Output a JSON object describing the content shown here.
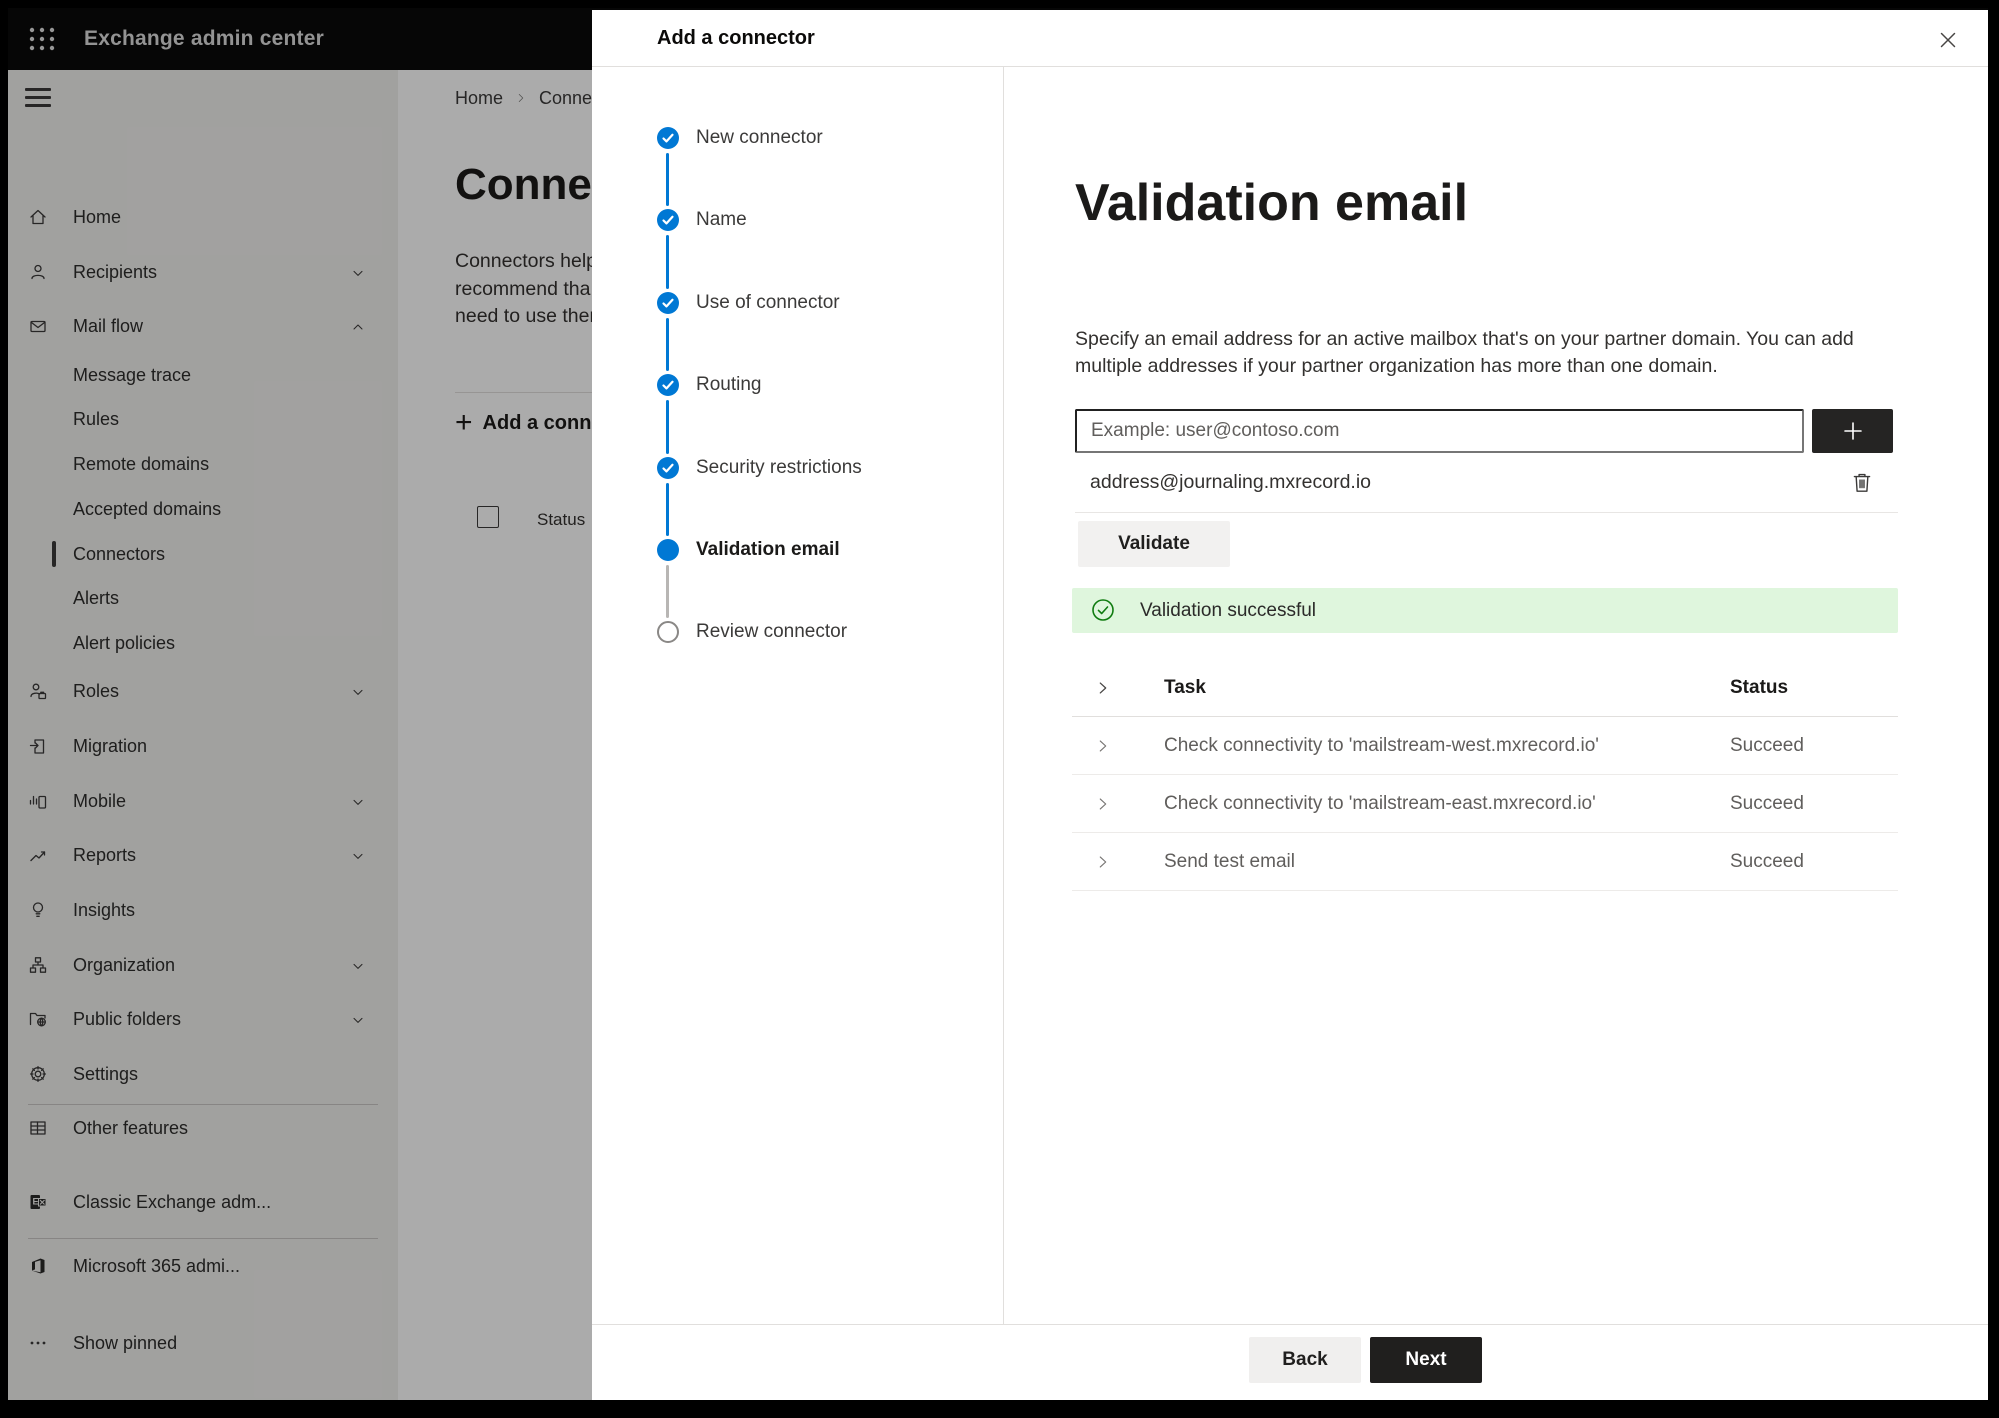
{
  "colors": {
    "accent": "#0078d4",
    "success": "#107c10",
    "success_bg": "#dff6dd",
    "topbar_bg": "#0a0a0a",
    "primary_btn": "#201f1e"
  },
  "icons": {
    "app_launcher": "waffle-grid-dots",
    "menu": "hamburger-lines",
    "step_done": "blue-circle-white-check",
    "step_current": "blue-filled-circle",
    "step_upcoming": "gray-outline-circle",
    "close": "x-cross",
    "add_address": "plus",
    "delete_address": "trash-outline",
    "success": "green-circle-check",
    "row_expander": "chevron-right",
    "nav_expand": "chevron-down",
    "nav_collapse": "chevron-up"
  },
  "topbar": {
    "title": "Exchange admin center"
  },
  "sidebar": {
    "items": [
      {
        "label": "Home"
      },
      {
        "label": "Recipients"
      },
      {
        "label": "Mail flow"
      },
      {
        "label": "Message trace"
      },
      {
        "label": "Rules"
      },
      {
        "label": "Remote domains"
      },
      {
        "label": "Accepted domains"
      },
      {
        "label": "Connectors"
      },
      {
        "label": "Alerts"
      },
      {
        "label": "Alert policies"
      },
      {
        "label": "Roles"
      },
      {
        "label": "Migration"
      },
      {
        "label": "Mobile"
      },
      {
        "label": "Reports"
      },
      {
        "label": "Insights"
      },
      {
        "label": "Organization"
      },
      {
        "label": "Public folders"
      },
      {
        "label": "Settings"
      },
      {
        "label": "Other features"
      },
      {
        "label": "Classic Exchange adm..."
      },
      {
        "label": "Microsoft 365 admi..."
      },
      {
        "label": "Show pinned"
      }
    ]
  },
  "page": {
    "breadcrumb_home": "Home",
    "breadcrumb_current": "Conne",
    "title_fragment": "Connec",
    "intro_lines": {
      "0": "Connectors help",
      "1": "recommend tha",
      "2": "need to use ther"
    },
    "add_connector_button": "Add a conn",
    "status_column": "Status"
  },
  "dialog": {
    "title": "Add a connector",
    "steps": [
      {
        "label": "New connector",
        "state": "done"
      },
      {
        "label": "Name",
        "state": "done"
      },
      {
        "label": "Use of connector",
        "state": "done"
      },
      {
        "label": "Routing",
        "state": "done"
      },
      {
        "label": "Security restrictions",
        "state": "done"
      },
      {
        "label": "Validation email",
        "state": "current"
      },
      {
        "label": "Review connector",
        "state": "upcoming"
      }
    ],
    "heading": "Validation email",
    "description": "Specify an email address for an active mailbox that's on your partner domain. You can add multiple addresses if your partner organization has more than one domain.",
    "email_input_placeholder": "Example: user@contoso.com",
    "added_address": "address@journaling.mxrecord.io",
    "validate_button": "Validate",
    "success_banner": "Validation successful",
    "table": {
      "task_header": "Task",
      "status_header": "Status",
      "rows": [
        {
          "task": "Check connectivity to 'mailstream-west.mxrecord.io'",
          "status": "Succeed"
        },
        {
          "task": "Check connectivity to 'mailstream-east.mxrecord.io'",
          "status": "Succeed"
        },
        {
          "task": "Send test email",
          "status": "Succeed"
        }
      ]
    },
    "back_button": "Back",
    "next_button": "Next"
  }
}
